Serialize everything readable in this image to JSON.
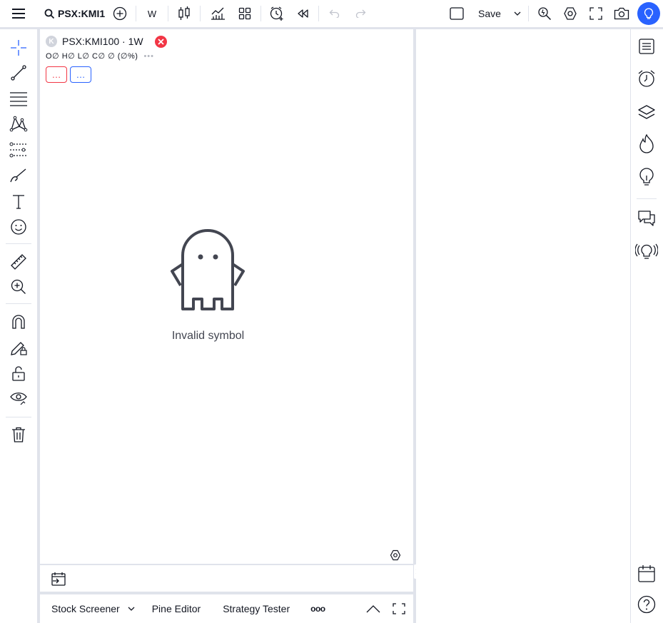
{
  "toolbar": {
    "symbol": "PSX:KMI1",
    "interval": "W",
    "save_label": "Save"
  },
  "legend": {
    "logo_letter": "K",
    "title": "PSX:KMI100 · 1W",
    "ohlc": "O∅ H∅ L∅ C∅ ∅ (∅%)",
    "more_dots": "•••",
    "pill_red": "…",
    "pill_blue": "…"
  },
  "chart": {
    "message": "Invalid symbol"
  },
  "bottom": {
    "stock_screener": "Stock Screener",
    "pine_editor": "Pine Editor",
    "strategy_tester": "Strategy Tester",
    "more": "ooo"
  },
  "colors": {
    "accent": "#2962ff",
    "error": "#f23645",
    "border": "#e0e3eb",
    "text": "#131722"
  }
}
